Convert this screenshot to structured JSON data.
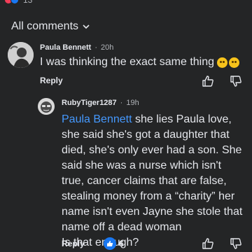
{
  "reactions": {
    "count": "13"
  },
  "header": {
    "title": "All comments"
  },
  "comments": [
    {
      "author": "Paula Bennett",
      "time": "20h",
      "text": "I was thinking the exact same thing",
      "reply_label": "Reply"
    },
    {
      "author": "RubyTiger1287",
      "time": "19h",
      "mention": "Paula Bennett",
      "text_after_mention": " she lies Paula love, she said she's got a daughter that died, she's only ever had a son. She said she was a nurse which isn't true, cancer claims that are false, stealing money from a “charity” her name isn't even Jayne she stole that name off a dead woman",
      "text_last": "Is that enough?",
      "reply_label": "Reply",
      "likes": "6"
    }
  ],
  "icons": {
    "chevron": "chevron-down-icon",
    "like": "thumbs-up-icon",
    "dislike": "thumbs-down-icon",
    "emoji": "grimacing-emoji"
  },
  "colors": {
    "background": "#242526",
    "mention": "#4599ff",
    "like_badge": "#1877f2"
  }
}
